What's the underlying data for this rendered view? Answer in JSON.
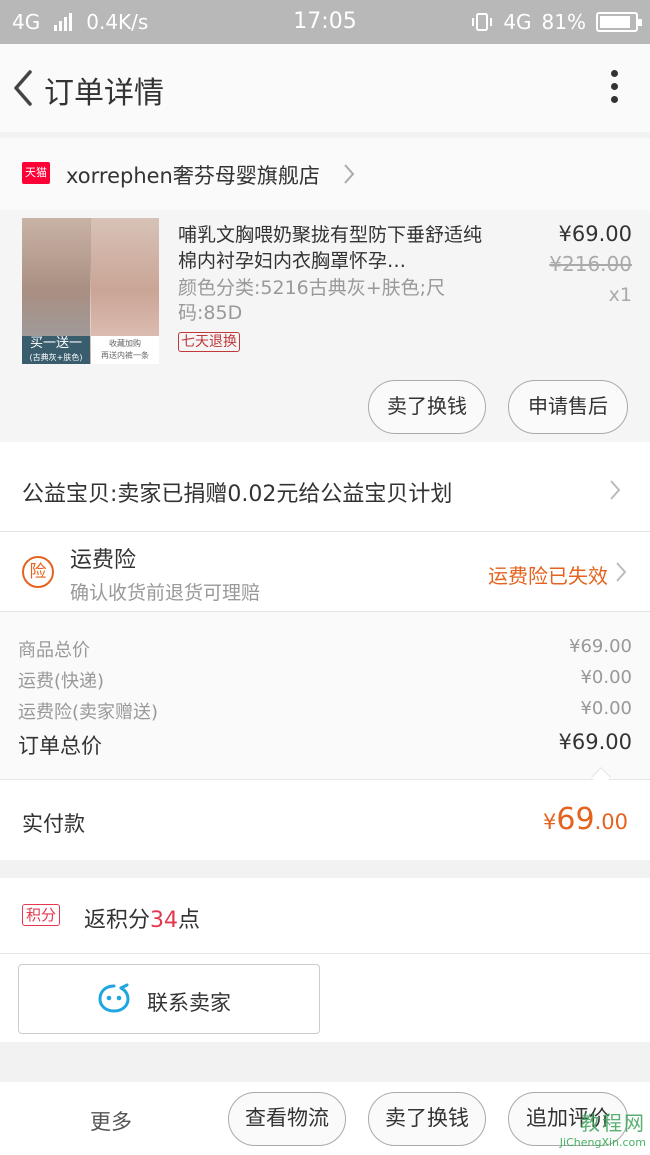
{
  "status_bar": {
    "network": "4G",
    "speed": "0.4K/s",
    "time": "17:05",
    "net_right": "4G",
    "battery": "81%"
  },
  "nav": {
    "title": "订单详情"
  },
  "shop": {
    "badge": "天猫",
    "name": "xorrephen奢芬母婴旗舰店"
  },
  "product": {
    "title": "哺乳文胸喂奶聚拢有型防下垂舒适纯棉内衬孕妇内衣胸罩怀孕…",
    "sku": "颜色分类:5216古典灰+肤色;尺码:85D",
    "tag": "七天退换",
    "price": "¥69.00",
    "original_price": "¥216.00",
    "quantity": "x1",
    "thumb_promo": "买一送一",
    "thumb_promo_sub": "(古典灰+肤色)",
    "thumb_promo2": "收藏加购",
    "thumb_promo2_sub": "再送内裤一条",
    "actions": {
      "sell": "卖了换钱",
      "after_sale": "申请售后"
    }
  },
  "charity": {
    "text": "公益宝贝:卖家已捐赠0.02元给公益宝贝计划"
  },
  "insurance": {
    "icon": "险",
    "title": "运费险",
    "subtitle": "确认收货前退货可理赔",
    "status": "运费险已失效"
  },
  "costs": {
    "rows": [
      {
        "label": "商品总价",
        "value": "¥69.00"
      },
      {
        "label": "运费(快递)",
        "value": "¥0.00"
      },
      {
        "label": "运费险(卖家赠送)",
        "value": "¥0.00"
      }
    ],
    "total": {
      "label": "订单总价",
      "value": "¥69.00"
    }
  },
  "paid": {
    "label": "实付款",
    "currency": "¥",
    "integer": "69",
    "decimal": ".00"
  },
  "points": {
    "badge": "积分",
    "prefix": "返积分",
    "value": "34",
    "suffix": "点"
  },
  "contact": {
    "label": "联系卖家"
  },
  "toolbar": {
    "more": "更多",
    "logistics": "查看物流",
    "sell": "卖了换钱",
    "review": "追加评价"
  },
  "watermark": {
    "title": "教程网",
    "url": "JiChengXin.com"
  },
  "colors": {
    "accent": "#e4631e",
    "points": "#e4384f",
    "tmall": "#ff0036",
    "tag": "#c0393b"
  }
}
